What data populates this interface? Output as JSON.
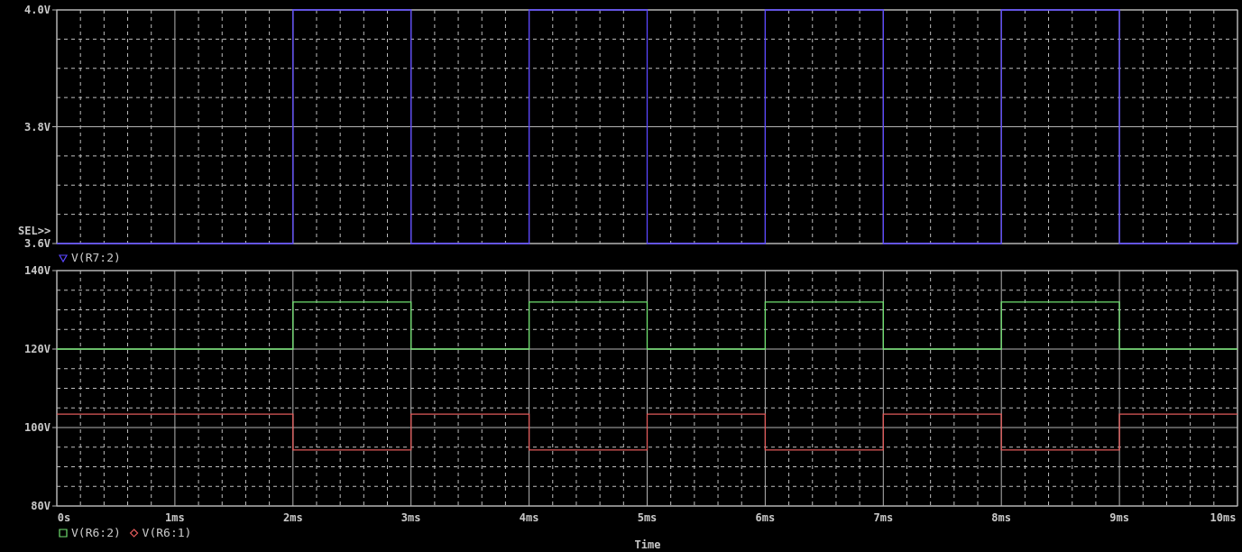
{
  "plots": [
    {
      "selection_marker": "SEL>>",
      "chart_data": {
        "type": "line",
        "grid": true,
        "legend": "bottom",
        "xlim": [
          0,
          10
        ],
        "ylim": [
          3.6,
          4.0
        ],
        "yticks": [
          {
            "value": 3.6,
            "label": "3.6V"
          },
          {
            "value": 3.8,
            "label": "3.8V"
          },
          {
            "value": 4.0,
            "label": "4.0V"
          }
        ],
        "x": [
          0,
          2,
          2,
          3,
          3,
          4,
          4,
          5,
          5,
          6,
          6,
          7,
          7,
          8,
          8,
          9,
          9,
          10
        ],
        "series": [
          {
            "name": "V(R7:2)",
            "color": "#5a46ff",
            "values": [
              3.6,
              3.6,
              4.0,
              4.0,
              3.6,
              3.6,
              4.0,
              4.0,
              3.6,
              3.6,
              4.0,
              4.0,
              3.6,
              3.6,
              4.0,
              4.0,
              3.6,
              3.6
            ]
          }
        ]
      }
    },
    {
      "chart_data": {
        "type": "line",
        "grid": true,
        "legend": "bottom",
        "xlabel": "Time",
        "xlim": [
          0,
          10
        ],
        "ylim": [
          80,
          140
        ],
        "xticks": [
          {
            "value": 0,
            "label": "0s"
          },
          {
            "value": 1,
            "label": "1ms"
          },
          {
            "value": 2,
            "label": "2ms"
          },
          {
            "value": 3,
            "label": "3ms"
          },
          {
            "value": 4,
            "label": "4ms"
          },
          {
            "value": 5,
            "label": "5ms"
          },
          {
            "value": 6,
            "label": "6ms"
          },
          {
            "value": 7,
            "label": "7ms"
          },
          {
            "value": 8,
            "label": "8ms"
          },
          {
            "value": 9,
            "label": "9ms"
          },
          {
            "value": 10,
            "label": "10ms"
          }
        ],
        "yticks": [
          {
            "value": 80,
            "label": "80V"
          },
          {
            "value": 100,
            "label": "100V"
          },
          {
            "value": 120,
            "label": "120V"
          },
          {
            "value": 140,
            "label": "140V"
          }
        ],
        "x": [
          0,
          2,
          2,
          3,
          3,
          4,
          4,
          5,
          5,
          6,
          6,
          7,
          7,
          8,
          8,
          9,
          9,
          10
        ],
        "series": [
          {
            "name": "V(R6:2)",
            "color": "#70e070",
            "values": [
              120,
              120,
              132,
              132,
              120,
              120,
              132,
              132,
              120,
              120,
              132,
              132,
              120,
              120,
              132,
              132,
              120,
              120
            ]
          },
          {
            "name": "V(R6:1)",
            "color": "#e05a5a",
            "values": [
              103.4,
              103.4,
              94.3,
              94.3,
              103.4,
              103.4,
              94.3,
              94.3,
              103.4,
              103.4,
              94.3,
              94.3,
              103.4,
              103.4,
              94.3,
              94.3,
              103.4,
              103.4
            ]
          }
        ]
      }
    }
  ]
}
